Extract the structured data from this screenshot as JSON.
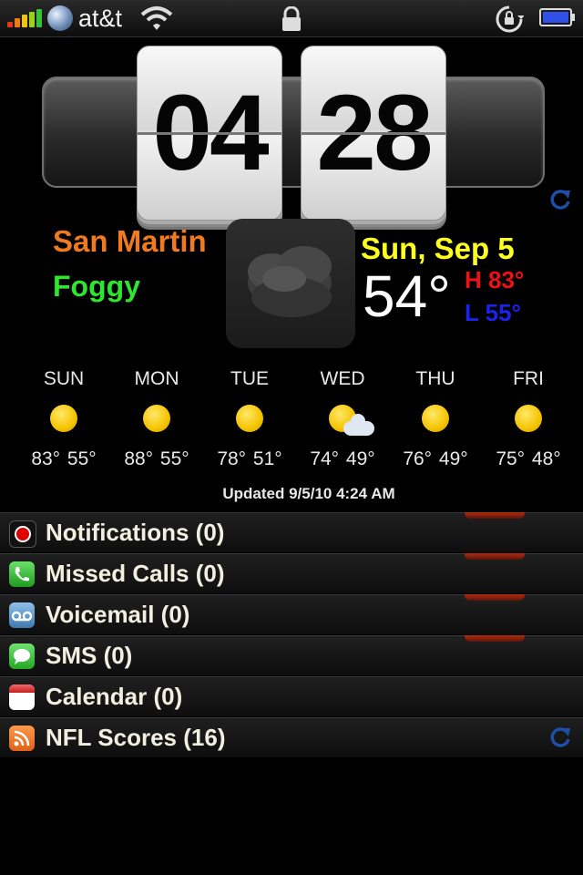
{
  "status_bar": {
    "carrier": "at&t"
  },
  "clock": {
    "hours": "04",
    "minutes": "28"
  },
  "weather": {
    "city": "San Martin",
    "condition": "Foggy",
    "date": "Sun, Sep 5",
    "temp": "54°",
    "high": "H 83°",
    "low": "L 55°",
    "icon": "fog-cloud-icon"
  },
  "forecast": [
    {
      "day": "SUN",
      "temps": "83° 55°",
      "icon": "sun-icon"
    },
    {
      "day": "MON",
      "temps": "88° 55°",
      "icon": "sun-icon"
    },
    {
      "day": "TUE",
      "temps": "78° 51°",
      "icon": "sun-icon"
    },
    {
      "day": "WED",
      "temps": "74° 49°",
      "icon": "partly-cloudy-icon"
    },
    {
      "day": "THU",
      "temps": "76° 49°",
      "icon": "sun-icon"
    },
    {
      "day": "FRI",
      "temps": "75° 48°",
      "icon": "sun-icon"
    }
  ],
  "updated": "Updated 9/5/10 4:24 AM",
  "list": [
    {
      "label": "Notifications (0)",
      "icon": "notification-icon",
      "color": "#c00000"
    },
    {
      "label": "Missed Calls (0)",
      "icon": "phone-icon",
      "color": "#2fb52f"
    },
    {
      "label": "Voicemail (0)",
      "icon": "voicemail-icon",
      "color": "#4a7fb0"
    },
    {
      "label": "SMS (0)",
      "icon": "sms-icon",
      "color": "#36b836"
    },
    {
      "label": "Calendar (0)",
      "icon": "calendar-icon",
      "color": "#e04848"
    },
    {
      "label": "NFL Scores (16)",
      "icon": "rss-icon",
      "color": "#f07a2a"
    }
  ],
  "colors": {
    "city": "#f07a1f",
    "condition": "#2ee62e",
    "date": "#ffff1e",
    "high": "#ee1111",
    "low": "#1a22ee",
    "refresh": "#1d4fa8"
  }
}
